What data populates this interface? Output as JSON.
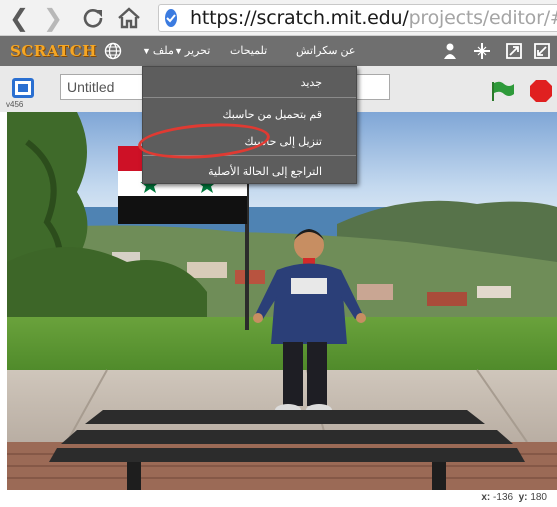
{
  "browser": {
    "back_icon": "back-arrow-icon",
    "forward_icon": "forward-arrow-icon",
    "reload_icon": "reload-icon",
    "home_icon": "home-icon",
    "url_host": "https://scratch.mit.edu/",
    "url_path": "projects/editor/#edit"
  },
  "menubar": {
    "logo": "SCRATCH",
    "items": [
      "ملف",
      "تحرير",
      "تلميحات",
      "عن سكراتش"
    ],
    "icons": [
      "globe-icon",
      "duplicate-icon",
      "cut-icon",
      "grow-icon",
      "shrink-icon"
    ]
  },
  "toolbar": {
    "project_title": "Untitled",
    "version": "v456",
    "green_flag_color": "#2e9a3a",
    "stop_color": "#e02020"
  },
  "file_menu": {
    "items": [
      "جديد",
      "قم بتحميل من حاسبك",
      "تنزيل إلى حاسبك",
      "التراجع إلى الحالة الأصلية"
    ],
    "highlighted_index": 2,
    "highlight_color": "#e03a32"
  },
  "stage": {
    "description_flag_colors": [
      "#ce1126",
      "#ffffff",
      "#000000",
      "#007a3d"
    ]
  },
  "status": {
    "x_label": "x:",
    "x_value": "-136",
    "y_label": "y:",
    "y_value": "180"
  }
}
